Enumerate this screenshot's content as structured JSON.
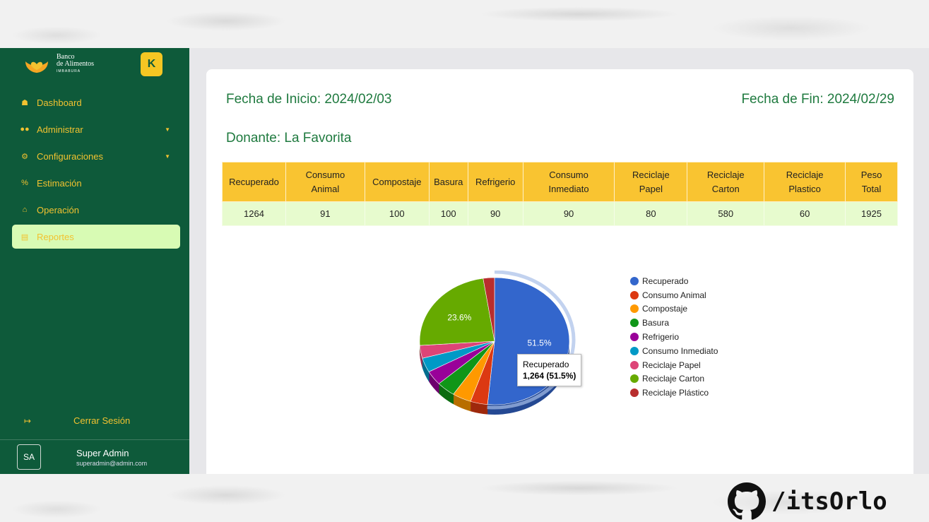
{
  "brand": {
    "line1": "Banco",
    "line2": "de Alimentos",
    "line3": "IMBABURA",
    "collapse_label": "K"
  },
  "sidebar": {
    "items": [
      {
        "label": "Dashboard",
        "icon": "home-icon"
      },
      {
        "label": "Administrar",
        "icon": "users-icon"
      },
      {
        "label": "Configuraciones",
        "icon": "gear-icon"
      },
      {
        "label": "Estimación",
        "icon": "percent-icon"
      },
      {
        "label": "Operación",
        "icon": "warehouse-icon"
      },
      {
        "label": "Reportes",
        "icon": "document-icon"
      }
    ],
    "logout_label": "Cerrar Sesión"
  },
  "user": {
    "initials": "SA",
    "name": "Super Admin",
    "email": "superadmin@admin.com"
  },
  "report": {
    "start_date": "Fecha de Inicio: 2024/02/03",
    "end_date": "Fecha de Fin: 2024/02/29",
    "donor": "Donante: La Favorita",
    "headers": [
      "Recuperado",
      "Consumo Animal",
      "Compostaje",
      "Basura",
      "Refrigerio",
      "Consumo Inmediato",
      "Reciclaje Papel",
      "Reciclaje Carton",
      "Reciclaje Plastico",
      "Peso Total"
    ],
    "values": [
      "1264",
      "91",
      "100",
      "100",
      "90",
      "90",
      "80",
      "580",
      "60",
      "1925"
    ]
  },
  "chart_data": {
    "type": "pie",
    "categories": [
      "Recuperado",
      "Consumo Animal",
      "Compostaje",
      "Basura",
      "Refrigerio",
      "Consumo Inmediato",
      "Reciclaje Papel",
      "Reciclaje Carton",
      "Reciclaje Plástico"
    ],
    "values": [
      1264,
      91,
      100,
      100,
      90,
      90,
      80,
      580,
      60
    ],
    "colors": [
      "#3366cc",
      "#dc3912",
      "#ff9900",
      "#109618",
      "#990099",
      "#0099c6",
      "#dd4477",
      "#66aa00",
      "#b82e2e"
    ],
    "slice_labels": [
      "51.5%",
      "23.6%"
    ],
    "tooltip": {
      "name": "Recuperado",
      "value": "1,264 (51.5%)"
    },
    "legend_position": "right"
  },
  "watermark": "/itsOrlo"
}
